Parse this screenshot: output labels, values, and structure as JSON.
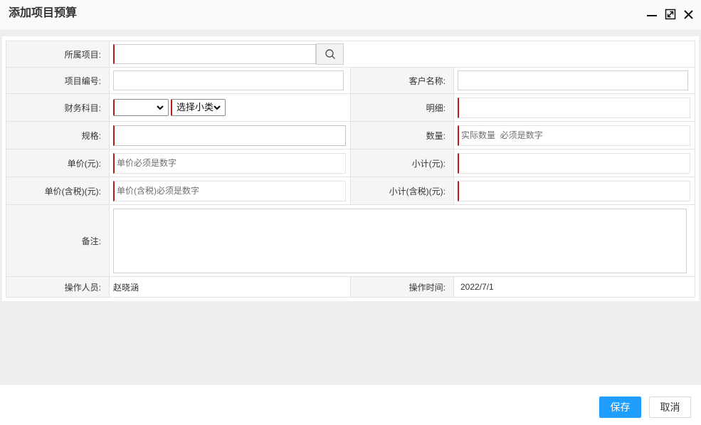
{
  "window": {
    "title": "添加项目预算",
    "icons": {
      "minimize": "minimize-icon",
      "maximize": "maximize-icon",
      "close": "close-icon",
      "search": "search-icon",
      "dropdown": "chevron-down-icon"
    }
  },
  "form": {
    "project": {
      "label": "所属项目:",
      "value": ""
    },
    "project_code": {
      "label": "项目编号:",
      "value": ""
    },
    "customer_name": {
      "label": "客户名称:",
      "value": ""
    },
    "finance_subject": {
      "label": "财务科目:",
      "category_value": "",
      "subcategory_value": "选择小类"
    },
    "detail": {
      "label": "明细:",
      "value": ""
    },
    "spec": {
      "label": "规格:",
      "value": ""
    },
    "quantity": {
      "label": "数量:",
      "value": "",
      "placeholder": "实际数量  必须是数字"
    },
    "unit_price": {
      "label": "单价(元):",
      "value": "",
      "placeholder": "单价必须是数字"
    },
    "subtotal": {
      "label": "小计(元):",
      "value": ""
    },
    "unit_price_tax": {
      "label": "单价(含税)(元):",
      "value": "",
      "placeholder": "单价(含税)必须是数字"
    },
    "subtotal_tax": {
      "label": "小计(含税)(元):",
      "value": ""
    },
    "remark": {
      "label": "备注:",
      "value": ""
    },
    "operator": {
      "label": "操作人员:",
      "value": "赵晓涵"
    },
    "operate_time": {
      "label": "操作时间:",
      "value": "2022/7/1"
    }
  },
  "footer": {
    "save_label": "保存",
    "cancel_label": "取消"
  },
  "colors": {
    "primary": "#1e9fff",
    "required_marker": "#b51c1c",
    "label_background": "#f5f5f5"
  }
}
